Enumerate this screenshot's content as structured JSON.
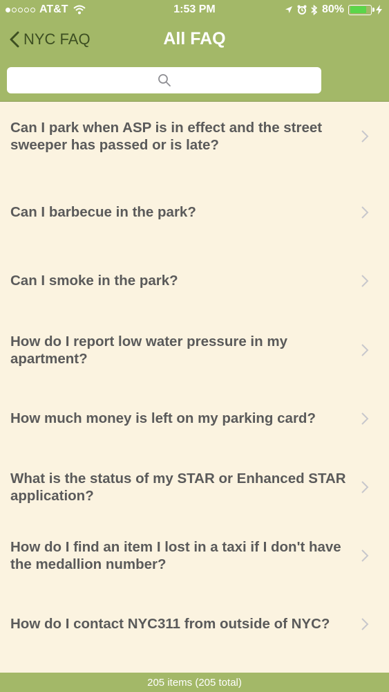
{
  "status_bar": {
    "carrier": "AT&T",
    "time": "1:53 PM",
    "battery_percent": "80%",
    "battery_level": 0.8
  },
  "nav": {
    "back_label": "NYC FAQ",
    "title": "All FAQ"
  },
  "search": {
    "placeholder": ""
  },
  "faq_items": [
    "Can I park when ASP is in effect and the street sweeper has passed or is late?",
    "Can I barbecue in the park?",
    "Can I smoke in the park?",
    "How do I report low water pressure in my apartment?",
    "How much money is left on my parking card?",
    "What is the status of my STAR or Enhanced STAR application?",
    "How do I find an item I lost in a taxi if I don't have the medallion number?",
    "How do I contact NYC311 from outside of NYC?"
  ],
  "footer": {
    "count_text": "205 items (205 total)"
  },
  "colors": {
    "header": "#a3b868",
    "background": "#fbf3e0",
    "back_text": "#3d4f22",
    "row_text": "#5a5a5a"
  }
}
